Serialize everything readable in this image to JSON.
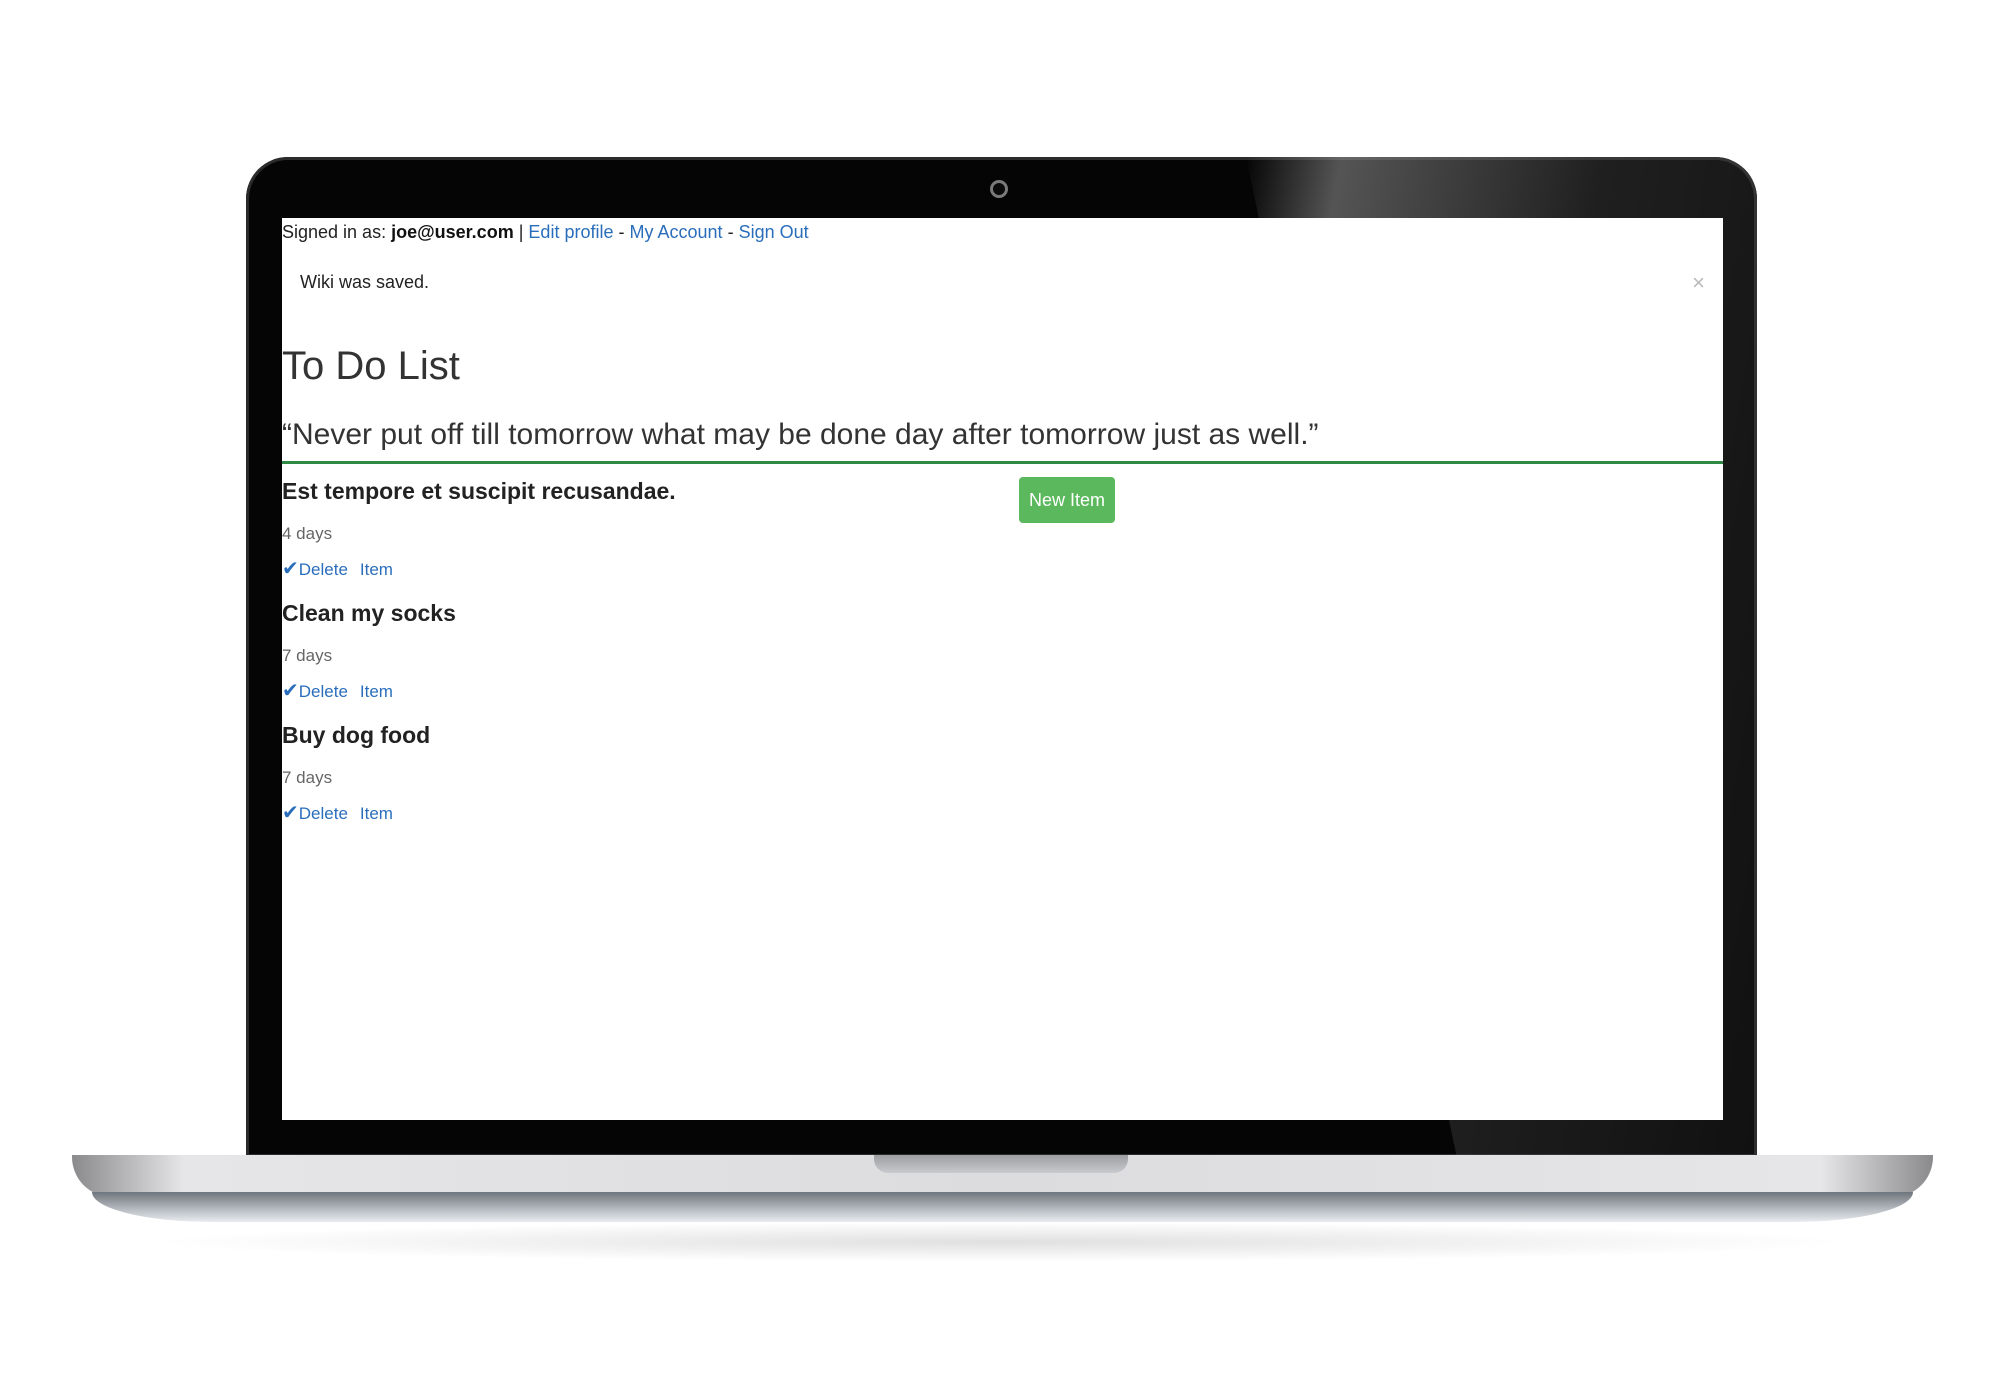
{
  "header": {
    "signed_in_label": "Signed in as:",
    "user_email": "joe@user.com",
    "separator": "|",
    "edit_profile": "Edit profile",
    "dash1": "-",
    "my_account": "My Account",
    "dash2": "-",
    "sign_out": "Sign Out"
  },
  "alert": {
    "message": "Wiki was saved.",
    "close": "×"
  },
  "page": {
    "title": "To Do List",
    "quote": "“Never put off till tomorrow what may be done day after tomorrow just as well.”",
    "new_item_button": "New Item"
  },
  "items": [
    {
      "title": "Est tempore et suscipit recusandae.",
      "age": "4 days",
      "check": "✔",
      "delete_label": "Delete",
      "item_label": "Item"
    },
    {
      "title": "Clean my socks",
      "age": "7 days",
      "check": "✔",
      "delete_label": "Delete",
      "item_label": "Item"
    },
    {
      "title": "Buy dog food",
      "age": "7 days",
      "check": "✔",
      "delete_label": "Delete",
      "item_label": "Item"
    }
  ],
  "colors": {
    "link": "#2a6ebb",
    "button": "#5cb85c",
    "divider": "#2f8a45"
  },
  "icons": {
    "camera": "camera-icon",
    "close": "close-icon",
    "check": "checkmark-icon"
  }
}
